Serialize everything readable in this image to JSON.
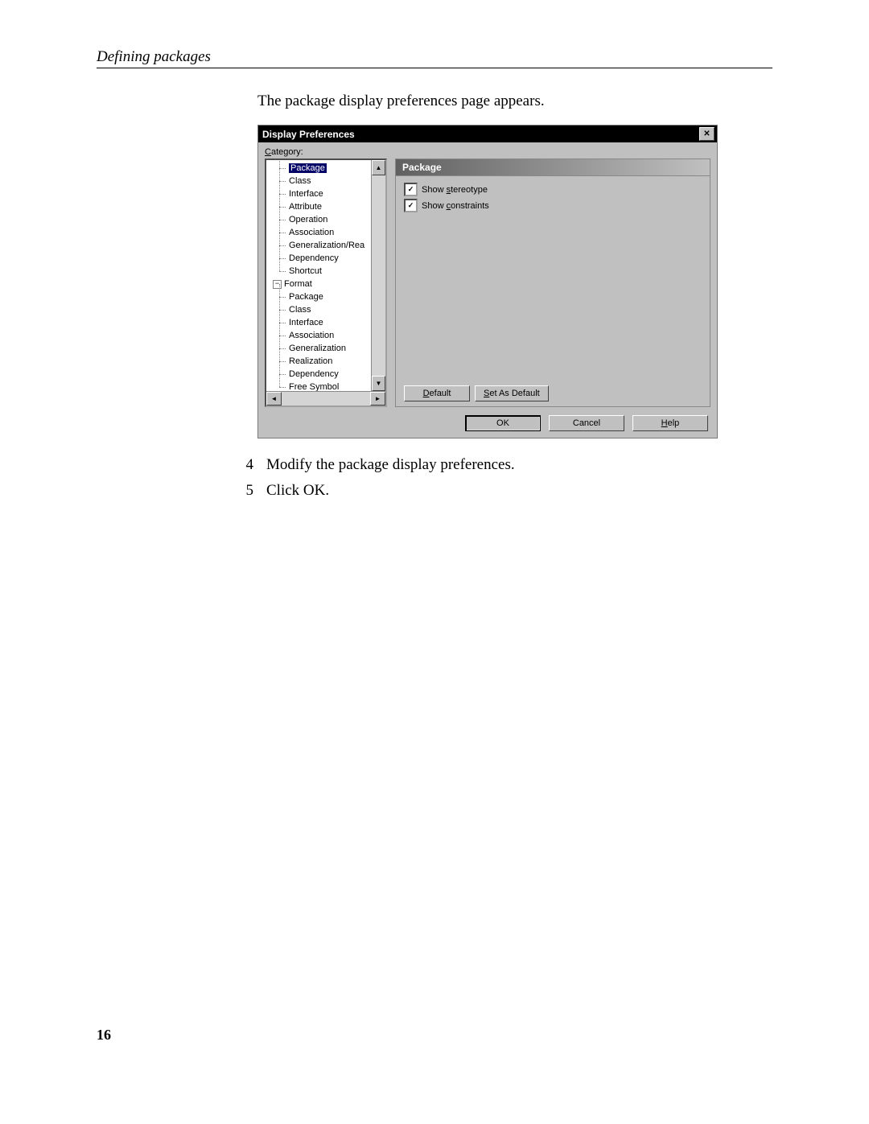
{
  "header": {
    "title": "Defining packages"
  },
  "intro": "The package display preferences page appears.",
  "dialog": {
    "title": "Display Preferences",
    "category_label": "Category:",
    "tree": {
      "group1": [
        "Package",
        "Class",
        "Interface",
        "Attribute",
        "Operation",
        "Association",
        "Generalization/Rea",
        "Dependency",
        "Shortcut"
      ],
      "group2_label": "Format",
      "group2": [
        "Package",
        "Class",
        "Interface",
        "Association",
        "Generalization",
        "Realization",
        "Dependency",
        "Free Symbol"
      ]
    },
    "pane": {
      "title": "Package",
      "chk1": "Show stereotype",
      "chk2": "Show constraints",
      "default_btn": "Default",
      "set_default_btn": "Set As Default"
    },
    "buttons": {
      "ok": "OK",
      "cancel": "Cancel",
      "help": "Help"
    }
  },
  "steps": [
    {
      "num": "4",
      "text": "Modify the package display preferences."
    },
    {
      "num": "5",
      "text": "Click OK."
    }
  ],
  "page_number": "16"
}
